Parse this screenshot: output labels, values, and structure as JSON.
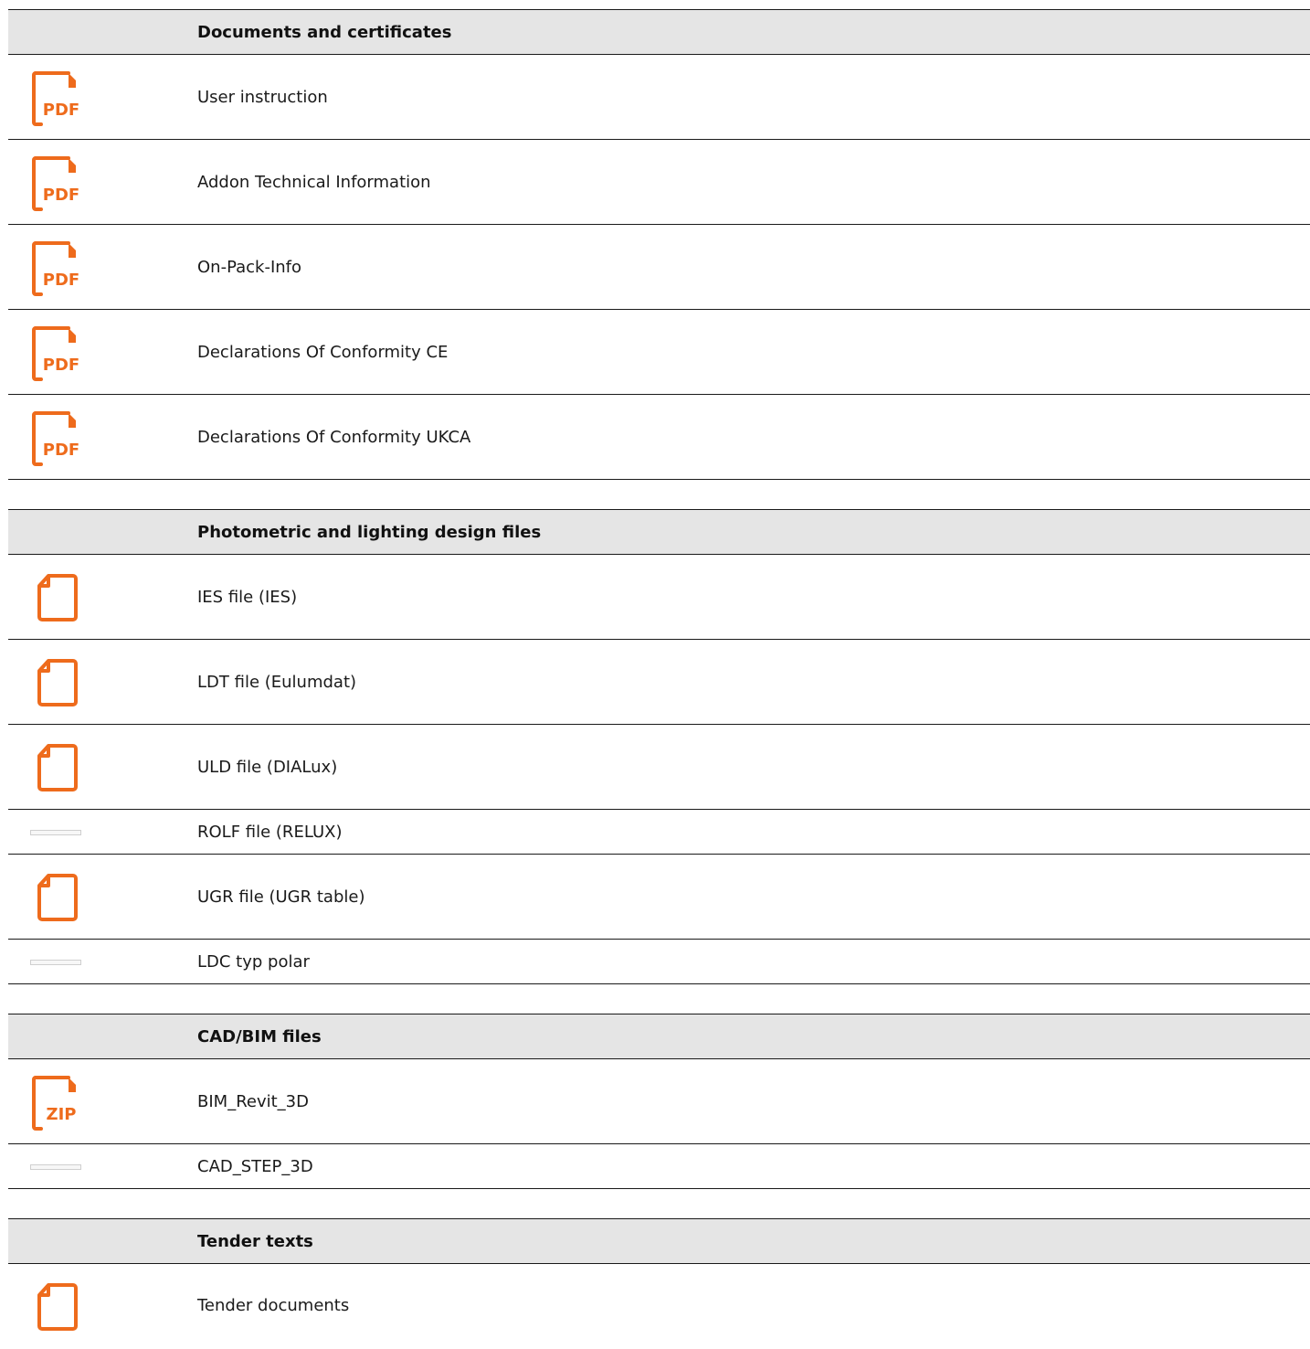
{
  "accent_color": "#ee6b1c",
  "sections": [
    {
      "title": "Documents and certificates",
      "items": [
        {
          "label": "User instruction",
          "icon": "pdf-icon",
          "badge": "PDF"
        },
        {
          "label": "Addon Technical Information",
          "icon": "pdf-icon",
          "badge": "PDF"
        },
        {
          "label": "On-Pack-Info",
          "icon": "pdf-icon",
          "badge": "PDF"
        },
        {
          "label": "Declarations Of Conformity CE",
          "icon": "pdf-icon",
          "badge": "PDF"
        },
        {
          "label": "Declarations Of Conformity UKCA",
          "icon": "pdf-icon",
          "badge": "PDF"
        }
      ]
    },
    {
      "title": "Photometric and lighting design files",
      "items": [
        {
          "label": "IES file (IES)",
          "icon": "file-icon"
        },
        {
          "label": "LDT file (Eulumdat)",
          "icon": "file-icon"
        },
        {
          "label": "ULD file (DIALux)",
          "icon": "file-icon"
        },
        {
          "label": "ROLF file (RELUX)",
          "icon": "placeholder-icon"
        },
        {
          "label": "UGR file (UGR table)",
          "icon": "file-icon"
        },
        {
          "label": "LDC typ polar",
          "icon": "placeholder-icon"
        }
      ]
    },
    {
      "title": "CAD/BIM files",
      "items": [
        {
          "label": "BIM_Revit_3D",
          "icon": "zip-icon",
          "badge": "ZIP"
        },
        {
          "label": "CAD_STEP_3D",
          "icon": "placeholder-icon"
        }
      ]
    },
    {
      "title": "Tender texts",
      "items": [
        {
          "label": "Tender documents",
          "icon": "file-icon"
        }
      ]
    }
  ]
}
